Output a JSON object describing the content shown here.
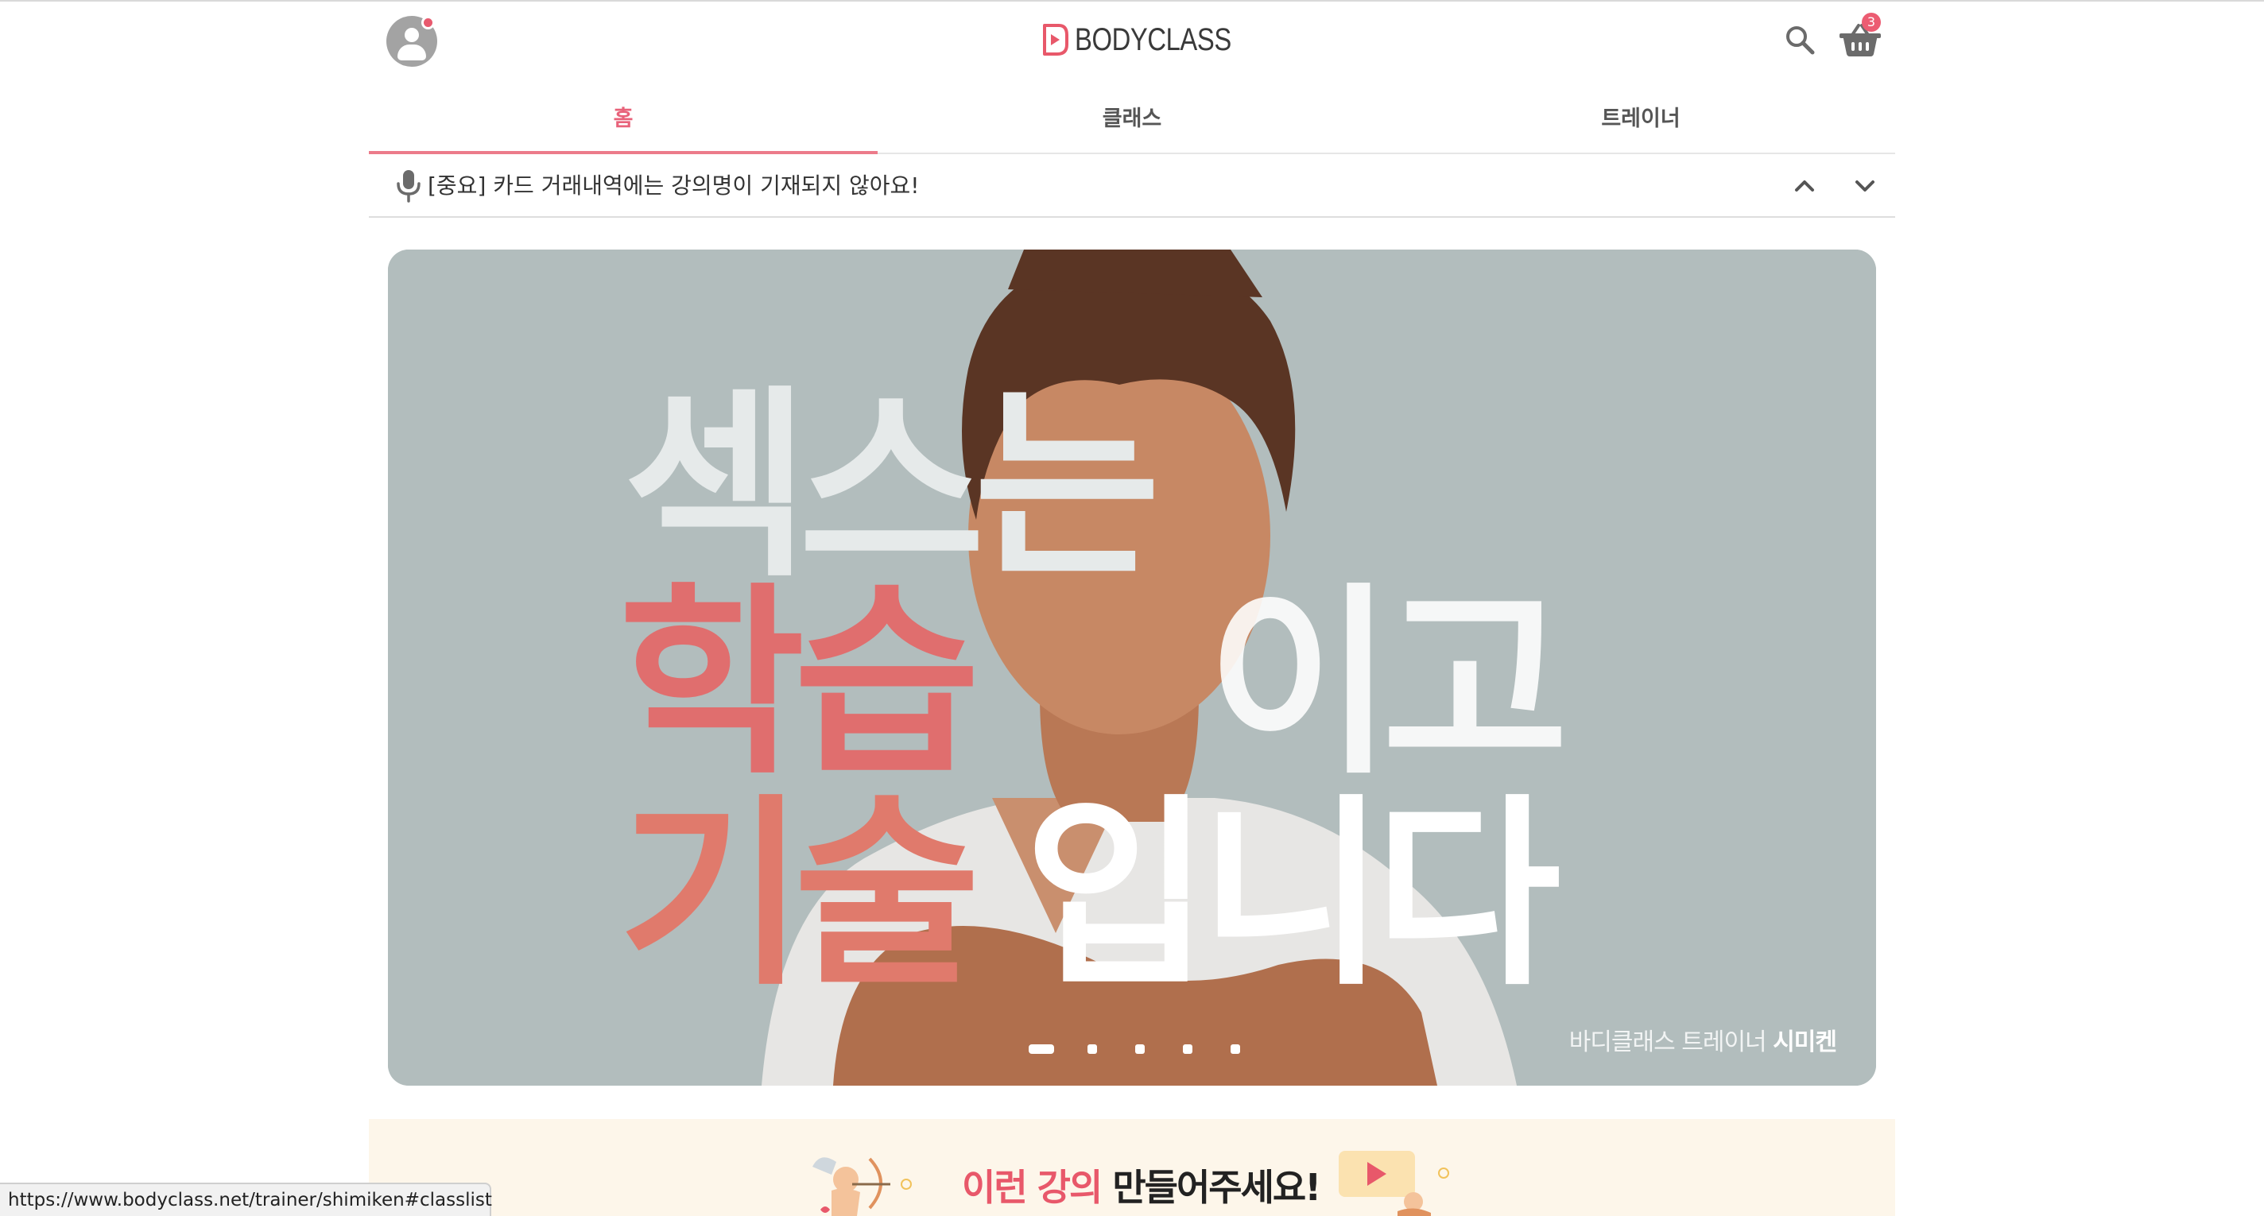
{
  "header": {
    "logo_text": "BODYCLASS",
    "cart_count": "3",
    "brand_color": "#e8586a",
    "icons": [
      "user-icon",
      "search-icon",
      "basket-icon"
    ]
  },
  "tabs": [
    {
      "label": "홈",
      "active": true
    },
    {
      "label": "클래스",
      "active": false
    },
    {
      "label": "트레이너",
      "active": false
    }
  ],
  "notice": {
    "text": "[중요] 카드 거래내역에는 강의명이 기재되지 않아요!",
    "icons": [
      "mic-icon",
      "chevron-up-icon",
      "chevron-down-icon"
    ]
  },
  "banner": {
    "headline_line1": "섹스는",
    "headline_line2_pink": "학습",
    "headline_line2_white": "이고",
    "headline_line3_pink": "기술",
    "headline_line3_white": "입니다",
    "caption_prefix": "바디클래스 트레이너",
    "caption_name": "시미켄",
    "slide_count": 5,
    "active_slide": 1
  },
  "promo": {
    "text_pink": "이런 강의",
    "text_dark": "만들어주세요!"
  },
  "status_bar": {
    "url": "https://www.bodyclass.net/trainer/shimiken#classlist"
  }
}
